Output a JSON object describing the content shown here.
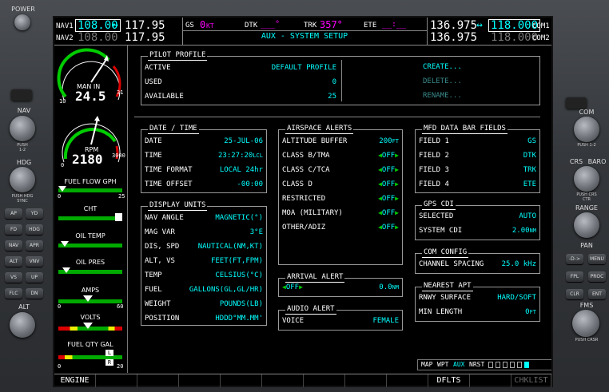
{
  "bezel": {
    "power": "POWER",
    "left_labels": [
      "NAV",
      "HDG",
      "ALT"
    ],
    "right_labels": [
      "COM",
      "CRS",
      "BARO",
      "RANGE",
      "PAN",
      "FMS"
    ],
    "left_keys": [
      "AP",
      "YD",
      "FD",
      "HDG",
      "NAV",
      "APR",
      "ALT",
      "VNV",
      "VS",
      "UP",
      "FLC",
      "DN"
    ],
    "right_keys": [
      "-D->",
      "MENU",
      "FPL",
      "PROC",
      "CLR",
      "ENT"
    ],
    "left_small": [
      "PUSH 1-2",
      "PUSH HDG SYNC"
    ],
    "right_small": [
      "PUSH 1-2",
      "PUSH CRS CTR",
      "PUSH CRSR"
    ]
  },
  "top": {
    "nav1_label": "NAV1",
    "nav1_active": "108.00",
    "nav1_arrow": "↔",
    "nav1_standby": "117.95",
    "nav2_label": "NAV2",
    "nav2_active": "108.00",
    "nav2_standby": "117.95",
    "gs_label": "GS",
    "gs_value": "0",
    "gs_unit": "KT",
    "dtk_label": "DTK",
    "dtk_value": "___°",
    "trk_label": "TRK",
    "trk_value": "357°",
    "ete_label": "ETE",
    "ete_value": "__:__",
    "page_title": "AUX - SYSTEM SETUP",
    "com1_standby": "136.975",
    "com1_arrow": "↔",
    "com1_active": "118.000",
    "com1_label": "COM1",
    "com2_standby": "136.975",
    "com2_active": "118.000",
    "com2_label": "COM2"
  },
  "engine": {
    "man_in": "24.5",
    "man_label": "MAN IN",
    "man_scale_min": "10",
    "man_scale_max": "31",
    "rpm": "2180",
    "rpm_label": "RPM",
    "rpm_scale_min": "0",
    "rpm_scale_max": "3000",
    "fuel_flow_label": "FUEL FLOW GPH",
    "fuel_flow_min": "0",
    "fuel_flow_max": "25",
    "cht_label": "CHT",
    "oil_temp_label": "OIL TEMP",
    "oil_pres_label": "OIL PRES",
    "amps_label": "AMPS",
    "amps_min": "0",
    "amps_max": "60",
    "volts_label": "VOLTS",
    "fuel_qty_label": "FUEL QTY GAL",
    "fuel_qty_min": "0",
    "fuel_qty_max": "20",
    "fuel_l": "L",
    "fuel_r": "R"
  },
  "pilot_profile": {
    "title": "PILOT PROFILE",
    "active_label": "ACTIVE",
    "active_value": "DEFAULT PROFILE",
    "used_label": "USED",
    "used_value": "0",
    "available_label": "AVAILABLE",
    "available_value": "25",
    "create": "CREATE...",
    "delete": "DELETE...",
    "rename": "RENAME..."
  },
  "date_time": {
    "title": "DATE / TIME",
    "date_label": "DATE",
    "date_value": "25-JUL-06",
    "time_label": "TIME",
    "time_value": "23:27:20",
    "time_unit": "LCL",
    "format_label": "TIME FORMAT",
    "format_value": "LOCAL 24hr",
    "offset_label": "TIME OFFSET",
    "offset_value": "-00:00"
  },
  "display_units": {
    "title": "DISPLAY UNITS",
    "rows": [
      {
        "label": "NAV ANGLE",
        "value": "MAGNETIC(°)"
      },
      {
        "label": "MAG VAR",
        "value": "3°E"
      },
      {
        "label": "DIS, SPD",
        "value": "NAUTICAL(NM,KT)"
      },
      {
        "label": "ALT, VS",
        "value": "FEET(FT,FPM)"
      },
      {
        "label": "TEMP",
        "value": "CELSIUS(°C)"
      },
      {
        "label": "FUEL",
        "value": "GALLONS(GL,GL/HR)"
      },
      {
        "label": "WEIGHT",
        "value": "POUNDS(LB)"
      },
      {
        "label": "POSITION",
        "value": "HDDD°MM.MM'"
      }
    ]
  },
  "airspace_alerts": {
    "title": "AIRSPACE ALERTS",
    "buffer_label": "ALTITUDE BUFFER",
    "buffer_value": "200",
    "buffer_unit": "FT",
    "rows": [
      {
        "label": "CLASS B/TMA",
        "value": "OFF"
      },
      {
        "label": "CLASS C/TCA",
        "value": "OFF"
      },
      {
        "label": "CLASS D",
        "value": "OFF"
      },
      {
        "label": "RESTRICTED",
        "value": "OFF"
      },
      {
        "label": "MOA (MILITARY)",
        "value": "OFF"
      },
      {
        "label": "OTHER/ADIZ",
        "value": "OFF"
      }
    ]
  },
  "arrival_alert": {
    "title": "ARRIVAL ALERT",
    "state": "OFF",
    "value": "0.0",
    "unit": "NM"
  },
  "audio_alert": {
    "title": "AUDIO ALERT",
    "voice_label": "VOICE",
    "voice_value": "FEMALE"
  },
  "mfd_fields": {
    "title": "MFD DATA BAR FIELDS",
    "rows": [
      {
        "label": "FIELD 1",
        "value": "GS"
      },
      {
        "label": "FIELD 2",
        "value": "DTK"
      },
      {
        "label": "FIELD 3",
        "value": "TRK"
      },
      {
        "label": "FIELD 4",
        "value": "ETE"
      }
    ]
  },
  "gps_cdi": {
    "title": "GPS CDI",
    "selected_label": "SELECTED",
    "selected_value": "AUTO",
    "system_label": "SYSTEM CDI",
    "system_value": "2.00",
    "system_unit": "NM"
  },
  "com_config": {
    "title": "COM CONFIG",
    "spacing_label": "CHANNEL SPACING",
    "spacing_value": "25.0 kHz"
  },
  "nearest_apt": {
    "title": "NEAREST APT",
    "surface_label": "RNWY SURFACE",
    "surface_value": "HARD/SOFT",
    "length_label": "MIN LENGTH",
    "length_value": "0",
    "length_unit": "FT"
  },
  "page_groups": {
    "labels": [
      "MAP",
      "WPT",
      "AUX",
      "NRST"
    ],
    "active": "AUX"
  },
  "softkeys": {
    "engine": "ENGINE",
    "dflts": "DFLTS",
    "chklist": "CHKLIST"
  }
}
